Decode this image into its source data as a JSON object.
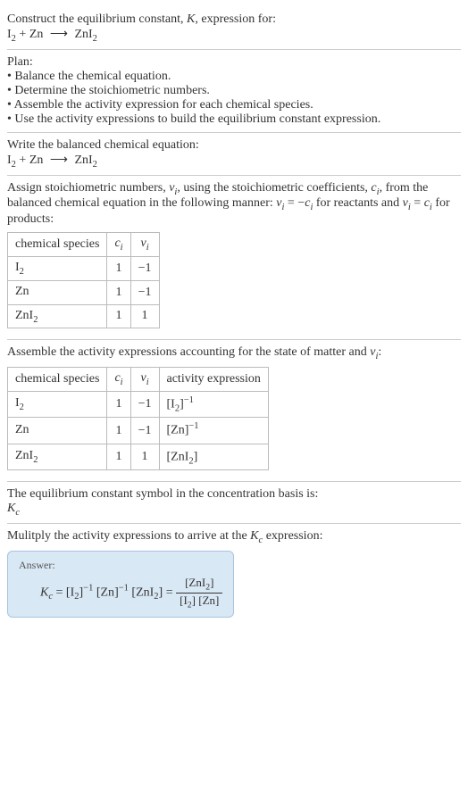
{
  "header": {
    "line1_pre": "Construct the equilibrium constant, ",
    "K": "K",
    "line1_post": ", expression for:",
    "equation_lhs": "I",
    "equation_lhs_sub": "2",
    "equation_plus": " + Zn ",
    "equation_arrow": "⟶",
    "equation_rhs": " ZnI",
    "equation_rhs_sub": "2"
  },
  "plan": {
    "title": "Plan:",
    "items": [
      "• Balance the chemical equation.",
      "• Determine the stoichiometric numbers.",
      "• Assemble the activity expression for each chemical species.",
      "• Use the activity expressions to build the equilibrium constant expression."
    ]
  },
  "balanced": {
    "title": "Write the balanced chemical equation:",
    "equation_lhs": "I",
    "equation_lhs_sub": "2",
    "equation_plus": " + Zn ",
    "equation_arrow": "⟶",
    "equation_rhs": " ZnI",
    "equation_rhs_sub": "2"
  },
  "stoich": {
    "intro_1": "Assign stoichiometric numbers, ",
    "nu_i": "ν",
    "nu_i_sub": "i",
    "intro_2": ", using the stoichiometric coefficients, ",
    "c_i": "c",
    "c_i_sub": "i",
    "intro_3": ", from the balanced chemical equation in the following manner: ",
    "rel1_lhs": "ν",
    "rel1_lhs_sub": "i",
    "rel1_eq": " = −",
    "rel1_rhs": "c",
    "rel1_rhs_sub": "i",
    "intro_4": " for reactants and ",
    "rel2_lhs": "ν",
    "rel2_lhs_sub": "i",
    "rel2_eq": " = ",
    "rel2_rhs": "c",
    "rel2_rhs_sub": "i",
    "intro_5": " for products:",
    "table": {
      "headers": {
        "species": "chemical species",
        "c": "c",
        "c_sub": "i",
        "nu": "ν",
        "nu_sub": "i"
      },
      "rows": [
        {
          "species": "I",
          "species_sub": "2",
          "c": "1",
          "nu": "−1"
        },
        {
          "species": "Zn",
          "species_sub": "",
          "c": "1",
          "nu": "−1"
        },
        {
          "species": "ZnI",
          "species_sub": "2",
          "c": "1",
          "nu": "1"
        }
      ]
    }
  },
  "activity": {
    "intro_1": "Assemble the activity expressions accounting for the state of matter and ",
    "nu": "ν",
    "nu_sub": "i",
    "intro_2": ":",
    "table": {
      "headers": {
        "species": "chemical species",
        "c": "c",
        "c_sub": "i",
        "nu": "ν",
        "nu_sub": "i",
        "act": "activity expression"
      },
      "rows": [
        {
          "species": "I",
          "species_sub": "2",
          "c": "1",
          "nu": "−1",
          "act_open": "[I",
          "act_sub": "2",
          "act_close": "]",
          "act_sup": "−1"
        },
        {
          "species": "Zn",
          "species_sub": "",
          "c": "1",
          "nu": "−1",
          "act_open": "[Zn",
          "act_sub": "",
          "act_close": "]",
          "act_sup": "−1"
        },
        {
          "species": "ZnI",
          "species_sub": "2",
          "c": "1",
          "nu": "1",
          "act_open": "[ZnI",
          "act_sub": "2",
          "act_close": "]",
          "act_sup": ""
        }
      ]
    }
  },
  "symbol": {
    "intro": "The equilibrium constant symbol in the concentration basis is:",
    "K": "K",
    "K_sub": "c"
  },
  "multiply": {
    "intro_1": "Mulitply the activity expressions to arrive at the ",
    "K": "K",
    "K_sub": "c",
    "intro_2": " expression:"
  },
  "answer": {
    "label": "Answer:",
    "Kc": "K",
    "Kc_sub": "c",
    "eq": " = ",
    "t1_open": "[I",
    "t1_sub": "2",
    "t1_close": "]",
    "t1_sup": "−1",
    "t2_open": " [Zn",
    "t2_close": "]",
    "t2_sup": "−1",
    "t3_open": " [ZnI",
    "t3_sub": "2",
    "t3_close": "]",
    "eq2": " = ",
    "num_open": "[ZnI",
    "num_sub": "2",
    "num_close": "]",
    "den_1_open": "[I",
    "den_1_sub": "2",
    "den_1_close": "]",
    "den_2_open": " [Zn",
    "den_2_close": "]"
  }
}
